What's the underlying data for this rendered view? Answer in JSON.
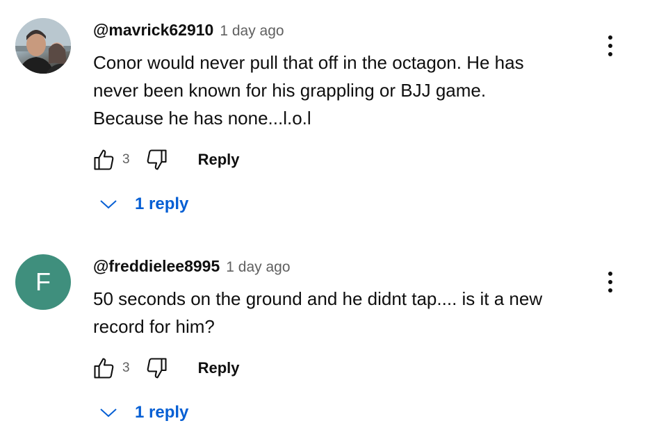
{
  "comments": [
    {
      "author": "@mavrick62910",
      "time": "1 day ago",
      "text": "Conor would never pull that off in the octagon. He has\nnever been known for his grappling or BJJ game.\nBecause he has none...l.o.l",
      "likes": "3",
      "reply_label": "Reply",
      "replies_label": "1 reply",
      "avatar_type": "photo"
    },
    {
      "author": "@freddielee8995",
      "time": "1 day ago",
      "text": "50 seconds on the ground and he didnt tap.... is it a new\nrecord for him?",
      "likes": "3",
      "reply_label": "Reply",
      "replies_label": "1 reply",
      "avatar_type": "letter",
      "avatar_letter": "F"
    }
  ],
  "colors": {
    "link": "#065fd4",
    "secondary_text": "#606060",
    "avatar_letter_bg": "#3f8f7d"
  },
  "icons": [
    "thumbs-up-icon",
    "thumbs-down-icon",
    "chevron-down-icon",
    "more-vert-icon"
  ]
}
